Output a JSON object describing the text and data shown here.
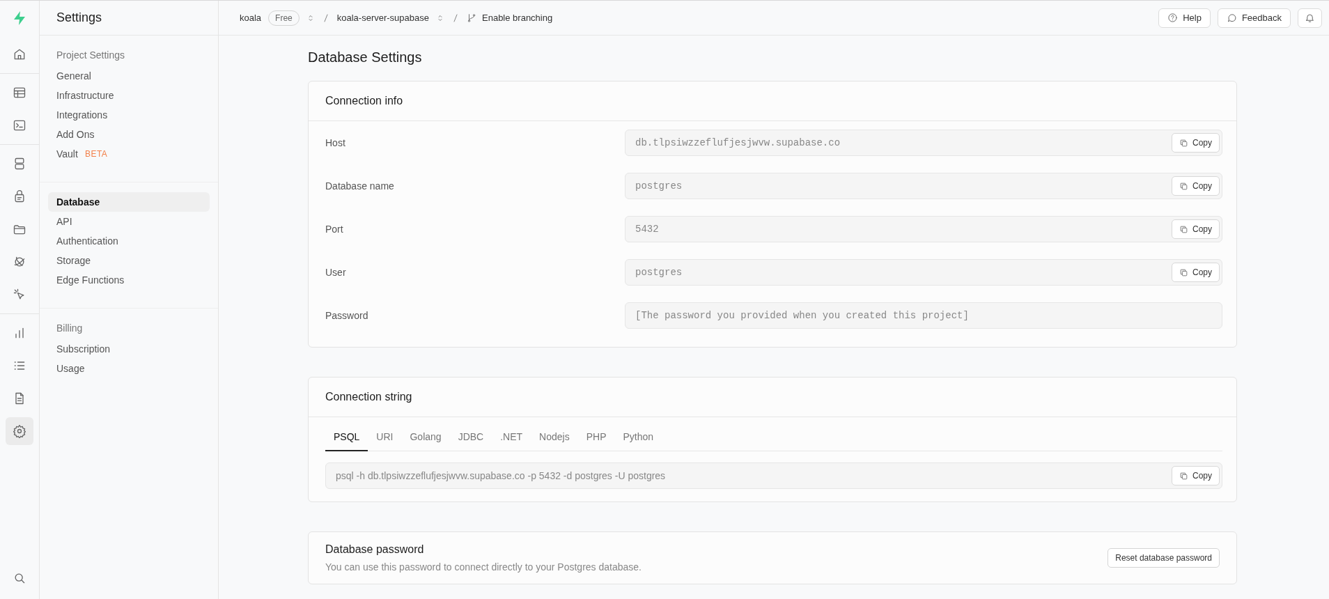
{
  "rail": {
    "groups": [
      [
        {
          "kind": "home",
          "selected": false
        }
      ],
      [
        {
          "kind": "table",
          "selected": false
        },
        {
          "kind": "terminal",
          "selected": false
        }
      ],
      [
        {
          "kind": "database",
          "selected": false
        },
        {
          "kind": "lock",
          "selected": false
        },
        {
          "kind": "folder",
          "selected": false
        },
        {
          "kind": "orbit",
          "selected": false
        },
        {
          "kind": "cursor",
          "selected": false
        }
      ],
      [
        {
          "kind": "chart",
          "selected": false
        },
        {
          "kind": "list",
          "selected": false
        },
        {
          "kind": "document",
          "selected": false
        },
        {
          "kind": "gear",
          "selected": true
        }
      ]
    ]
  },
  "sidebar": {
    "title": "Settings",
    "sections": [
      {
        "heading": "Project Settings",
        "items": [
          {
            "label": "General",
            "selected": false
          },
          {
            "label": "Infrastructure",
            "selected": false
          },
          {
            "label": "Integrations",
            "selected": false
          },
          {
            "label": "Add Ons",
            "selected": false
          },
          {
            "label": "Vault",
            "badge": "BETA",
            "selected": false
          }
        ]
      },
      {
        "items": [
          {
            "label": "Database",
            "selected": true
          },
          {
            "label": "API",
            "selected": false
          },
          {
            "label": "Authentication",
            "selected": false
          },
          {
            "label": "Storage",
            "selected": false
          },
          {
            "label": "Edge Functions",
            "selected": false
          }
        ]
      },
      {
        "heading": "Billing",
        "items": [
          {
            "label": "Subscription",
            "selected": false
          },
          {
            "label": "Usage",
            "selected": false
          }
        ]
      }
    ]
  },
  "topbar": {
    "organization": "koala",
    "plan": "Free",
    "project": "koala-server-supabase",
    "branching": "Enable branching",
    "help": "Help",
    "feedback": "Feedback"
  },
  "page": {
    "title": "Database Settings"
  },
  "connection_info": {
    "title": "Connection info",
    "fields": [
      {
        "label": "Host",
        "value": "db.tlpsiwzzeflufjesjwvw.supabase.co",
        "copy": "Copy"
      },
      {
        "label": "Database name",
        "value": "postgres",
        "copy": "Copy"
      },
      {
        "label": "Port",
        "value": "5432",
        "copy": "Copy"
      },
      {
        "label": "User",
        "value": "postgres",
        "copy": "Copy"
      },
      {
        "label": "Password",
        "value": "[The password you provided when you created this project]"
      }
    ]
  },
  "connection_string": {
    "title": "Connection string",
    "tabs": [
      {
        "label": "PSQL",
        "selected": true
      },
      {
        "label": "URI",
        "selected": false
      },
      {
        "label": "Golang",
        "selected": false
      },
      {
        "label": "JDBC",
        "selected": false
      },
      {
        "label": ".NET",
        "selected": false
      },
      {
        "label": "Nodejs",
        "selected": false
      },
      {
        "label": "PHP",
        "selected": false
      },
      {
        "label": "Python",
        "selected": false
      }
    ],
    "value": "psql -h db.tlpsiwzzeflufjesjwvw.supabase.co -p 5432 -d postgres -U postgres",
    "copy": "Copy"
  },
  "database_password": {
    "title": "Database password",
    "description": "You can use this password to connect directly to your Postgres database.",
    "button": "Reset database password"
  }
}
